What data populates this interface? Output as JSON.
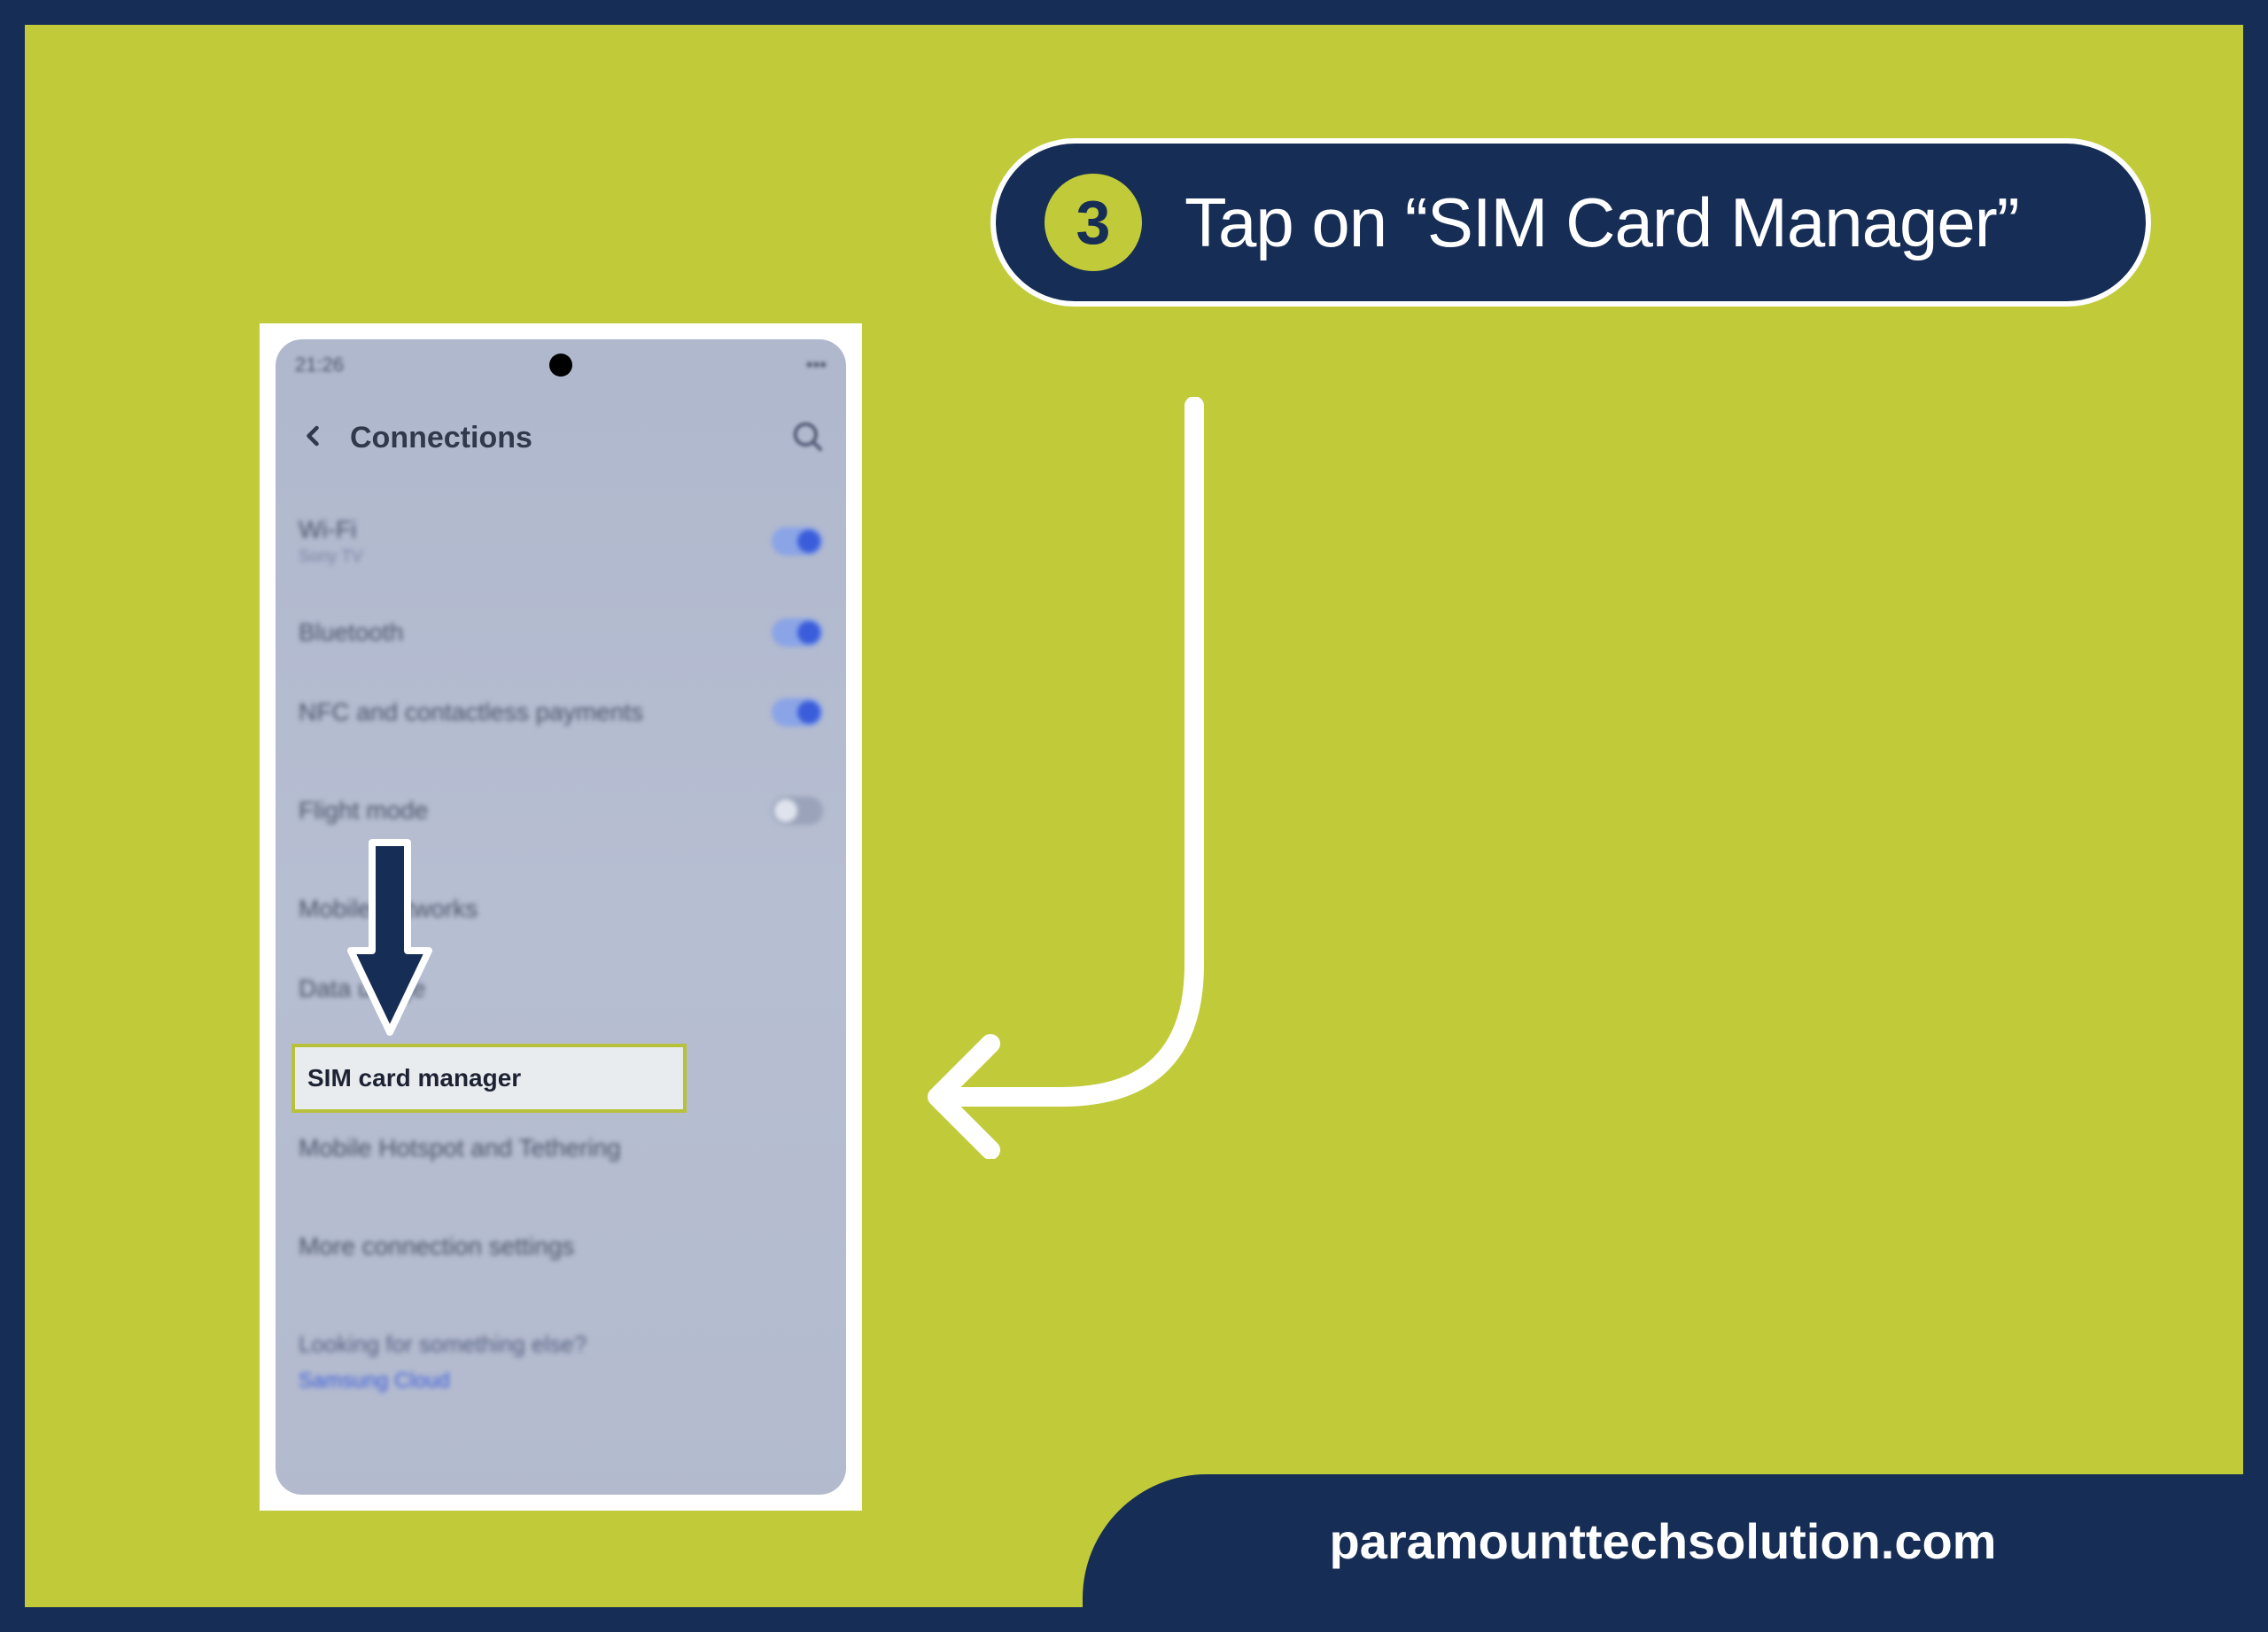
{
  "callout": {
    "step_number": "3",
    "text": "Tap on “SIM Card Manager”"
  },
  "footer": {
    "site": "paramounttechsolution.com"
  },
  "phone": {
    "status": {
      "time": "21:26",
      "right": "•••"
    },
    "header": {
      "title": "Connections"
    },
    "rows": {
      "wifi": {
        "label": "Wi-Fi",
        "sub": "Sony TV",
        "toggle": true
      },
      "bluetooth": {
        "label": "Bluetooth",
        "toggle": true
      },
      "nfc": {
        "label": "NFC and contactless payments",
        "toggle": true
      },
      "flight": {
        "label": "Flight mode",
        "toggle": false
      },
      "mobile_networks": {
        "label": "Mobile networks"
      },
      "data_usage": {
        "label": "Data usage"
      },
      "sim": {
        "label": "SIM card manager"
      },
      "hotspot": {
        "label": "Mobile Hotspot and Tethering"
      },
      "more": {
        "label": "More connection settings"
      },
      "looking": {
        "label": "Looking for something else?"
      },
      "cloud": {
        "label": "Samsung Cloud"
      }
    }
  }
}
